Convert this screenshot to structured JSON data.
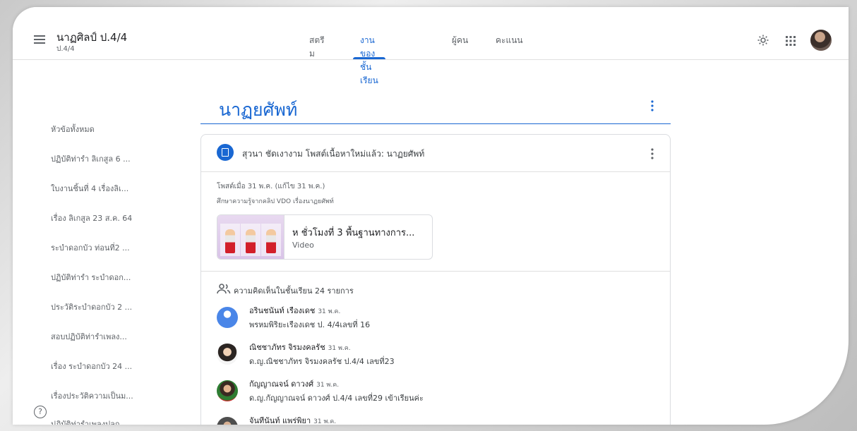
{
  "header": {
    "class_title": "นาฏศิลป์ ป.4/4",
    "class_section": "ป.4/4"
  },
  "tabs": [
    {
      "label": "สตรีม"
    },
    {
      "label": "งานของชั้นเรียน"
    },
    {
      "label": "ผู้คน"
    },
    {
      "label": "คะแนน"
    }
  ],
  "sidebar": {
    "items": [
      {
        "label": "หัวข้อทั้งหมด"
      },
      {
        "label": "ปฏิบัติท่ารำ ลิเกสูล 6 ..."
      },
      {
        "label": "ใบงานชิ้นที่ 4 เรื่องลิเ..."
      },
      {
        "label": "เรื่อง ลิเกสูล 23 ส.ค. 64"
      },
      {
        "label": "ระบำดอกบัว ท่อนที่2 ..."
      },
      {
        "label": "ปฏิบัติท่ารำ ระบำดอก..."
      },
      {
        "label": "ประวัติระบำดอกบัว 2 ..."
      },
      {
        "label": "สอบปฏิบัติท่ารำเพลง..."
      },
      {
        "label": "เรื่อง ระบำดอกบัว 24 ..."
      },
      {
        "label": "เรื่องประวัติความเป็นม..."
      },
      {
        "label": "ปฏิบัติท่ารำเพลงปลุก..."
      }
    ]
  },
  "topic": {
    "title": "นาฏยศัพท์"
  },
  "post": {
    "header": "สุวนา ชัดเงางาม โพสต์เนื้อหาใหม่แล้ว: นาฏยศัพท์",
    "posted": "โพสต์เมื่อ 31 พ.ค. (แก้ไข 31 พ.ค.)",
    "description": "ศึกษาความรู้จากคลิป VDO เรื่องนาฏยศัพท์",
    "attachment": {
      "title": "ห ชั่วโมงที่ 3 พื้นฐานทางการ...",
      "type": "Video"
    },
    "comments_count": "ความคิดเห็นในชั้นเรียน 24 รายการ",
    "comments": [
      {
        "name": "อรินชนันท์ เรืองเดช",
        "date": "31 พ.ค.",
        "text": "พรหมพิริยะเรืองเดช ป. 4/4เลขที่ 16"
      },
      {
        "name": "ณิชชาภัทร จิรมงคลรัช",
        "date": "31 พ.ค.",
        "text": "ด.ญ.ณิชชาภัทร จิรมงคลรัช  ป.4/4  เลขที่23"
      },
      {
        "name": "กัญญาณจน์ ดาวงศ์",
        "date": "31 พ.ค.",
        "text": "ด.ญ.กัญญาณจน์ ดาวงศ์ ป.4/4 เลขที่29 เข้าเรียนค่ะ"
      },
      {
        "name": "จันทีนันท์ แพร่พิยา",
        "date": "31 พ.ค.",
        "text": ""
      }
    ]
  },
  "colors": {
    "accent": "#1967d2",
    "text": "#3c4043",
    "muted": "#5f6368",
    "divider": "#e0e0e0"
  },
  "icons": {
    "menu": "menu-icon",
    "settings": "gear-icon",
    "apps": "apps-grid-icon",
    "help": "help-icon",
    "more": "more-vert-icon",
    "assignment": "material-icon",
    "people": "people-icon"
  }
}
